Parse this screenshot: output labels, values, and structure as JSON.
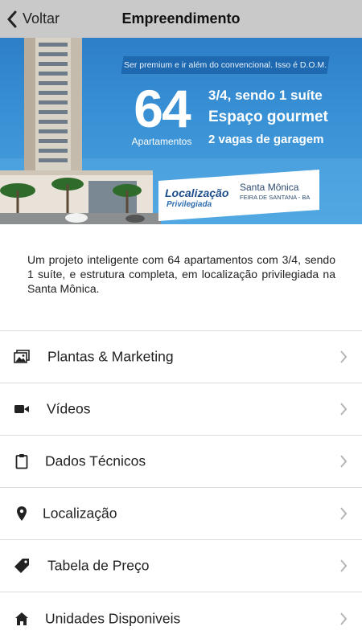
{
  "header": {
    "back_label": "Voltar",
    "title": "Empreendimento"
  },
  "banner": {
    "tagline": "Ser premium e ir além do convencional. Isso é D.O.M.",
    "apartments_count": "64",
    "apartments_label": "Apartamentos",
    "features": [
      "3/4, sendo 1 suíte",
      "Espaço gourmet",
      "2 vagas de garagem"
    ],
    "location_title": "Localização",
    "location_subtitle": "Privilegiada",
    "location_place": "Santa Mônica",
    "location_city": "FEIRA DE SANTANA - BA"
  },
  "description": "Um projeto inteligente com 64 apartamentos com 3/4, sendo 1 suíte, e estrutura completa, em localização privilegiada na Santa Mônica.",
  "menu": {
    "items": [
      {
        "label": "Plantas & Marketing",
        "icon": "image-gallery-icon"
      },
      {
        "label": "Vídeos",
        "icon": "video-camera-icon"
      },
      {
        "label": "Dados Técnicos",
        "icon": "clipboard-icon"
      },
      {
        "label": "Localização",
        "icon": "map-pin-icon"
      },
      {
        "label": "Tabela de Preço",
        "icon": "price-tag-icon"
      },
      {
        "label": "Unidades Disponiveis",
        "icon": "home-icon"
      }
    ]
  },
  "colors": {
    "header_bg": "#c9c9c9",
    "banner_blue": "#3a92d6",
    "divider": "#dcdcdc",
    "chevron": "#b5b5b5"
  }
}
